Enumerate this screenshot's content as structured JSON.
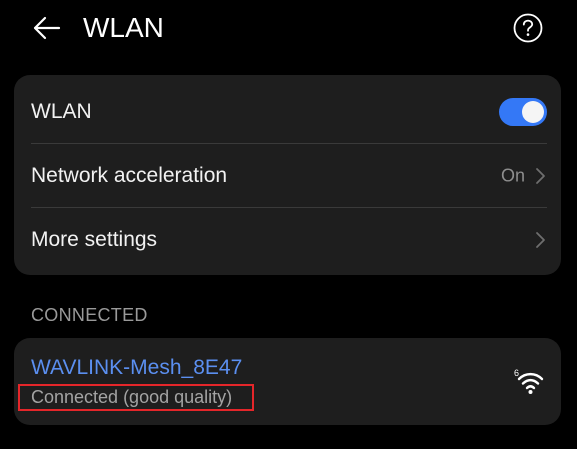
{
  "header": {
    "title": "WLAN",
    "back_icon": "arrow-left-icon",
    "help_icon": "help-circle-icon"
  },
  "settings": {
    "wlan": {
      "label": "WLAN",
      "toggle_on": true
    },
    "network_acceleration": {
      "label": "Network acceleration",
      "value": "On"
    },
    "more_settings": {
      "label": "More settings"
    }
  },
  "connected_section": {
    "label": "CONNECTED",
    "network": {
      "name": "WAVLINK-Mesh_8E47",
      "status": "Connected (good quality)",
      "band_badge": "6",
      "icon": "wifi-6-icon"
    }
  },
  "colors": {
    "background": "#000000",
    "card": "#1e1e1e",
    "accent": "#3478f6",
    "network_name": "#5b8ff0",
    "highlight_box": "#e5262a"
  }
}
